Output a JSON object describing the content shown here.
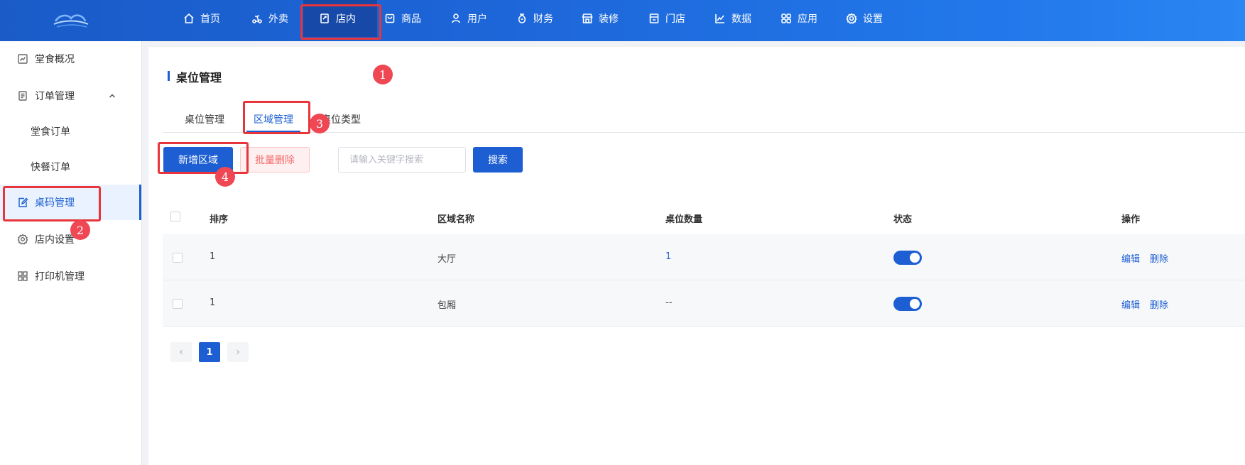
{
  "topnav": {
    "items": [
      {
        "label": "首页",
        "icon": "home-icon"
      },
      {
        "label": "外卖",
        "icon": "scooter-icon"
      },
      {
        "label": "店内",
        "icon": "store-inside-icon"
      },
      {
        "label": "商品",
        "icon": "bag-icon"
      },
      {
        "label": "用户",
        "icon": "user-icon"
      },
      {
        "label": "财务",
        "icon": "money-bag-icon"
      },
      {
        "label": "装修",
        "icon": "storefront-icon"
      },
      {
        "label": "门店",
        "icon": "shop-icon"
      },
      {
        "label": "数据",
        "icon": "chart-icon"
      },
      {
        "label": "应用",
        "icon": "apps-icon"
      },
      {
        "label": "设置",
        "icon": "gear-icon"
      }
    ],
    "active": "店内"
  },
  "sidebar": {
    "items": [
      {
        "label": "堂食概况",
        "icon": "chart-line-icon"
      },
      {
        "label": "订单管理",
        "icon": "document-icon",
        "expanded": true
      },
      {
        "label": "堂食订单"
      },
      {
        "label": "快餐订单"
      },
      {
        "label": "桌码管理",
        "icon": "edit-note-icon",
        "active": true
      },
      {
        "label": "店内设置",
        "icon": "gear-icon"
      },
      {
        "label": "打印机管理",
        "icon": "grid-icon"
      }
    ]
  },
  "page": {
    "title": "桌位管理",
    "tabs": [
      "桌位管理",
      "区域管理",
      "桌位类型"
    ],
    "active_tab": "区域管理"
  },
  "toolbar": {
    "add_label": "新增区域",
    "batch_delete_label": "批量删除",
    "search_placeholder": "请输入关键字搜索",
    "search_value": "",
    "search_button": "搜索"
  },
  "table": {
    "headers": [
      "排序",
      "区域名称",
      "桌位数量",
      "状态",
      "操作"
    ],
    "rows": [
      {
        "sort": "1",
        "name": "大厅",
        "count": "1",
        "status": true,
        "edit": "编辑",
        "delete": "删除"
      },
      {
        "sort": "1",
        "name": "包厢",
        "count": "--",
        "status": true,
        "edit": "编辑",
        "delete": "删除"
      }
    ]
  },
  "pagination": {
    "current": "1",
    "prev": "‹",
    "next": "›"
  },
  "annotations": [
    "1",
    "2",
    "3",
    "4"
  ],
  "colors": {
    "primary": "#1d5fd3",
    "annotation": "#e8343b",
    "danger_text": "#f56c6c"
  }
}
